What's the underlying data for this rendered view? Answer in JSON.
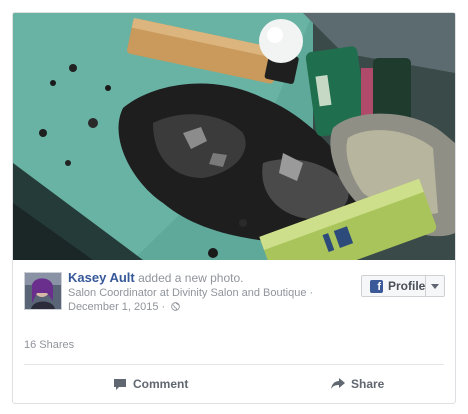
{
  "post": {
    "author_name": "Kasey Ault",
    "action_text": "added a new photo.",
    "subtitle": "Salon Coordinator at Divinity Salon and Boutique ·",
    "date": "December 1, 2015 ·",
    "profile_button_label": "Profile",
    "shares_text": "16 Shares",
    "comment_label": "Comment",
    "share_label": "Share"
  },
  "icons": {
    "facebook": "facebook-f-icon",
    "globe": "globe-icon",
    "comment": "speech-bubble-icon",
    "share": "share-arrow-icon",
    "caret": "caret-down-icon"
  },
  "colors": {
    "name_link": "#365899",
    "muted_text": "#90949c",
    "facebook_blue": "#3b5998",
    "border": "#dddfe2"
  }
}
